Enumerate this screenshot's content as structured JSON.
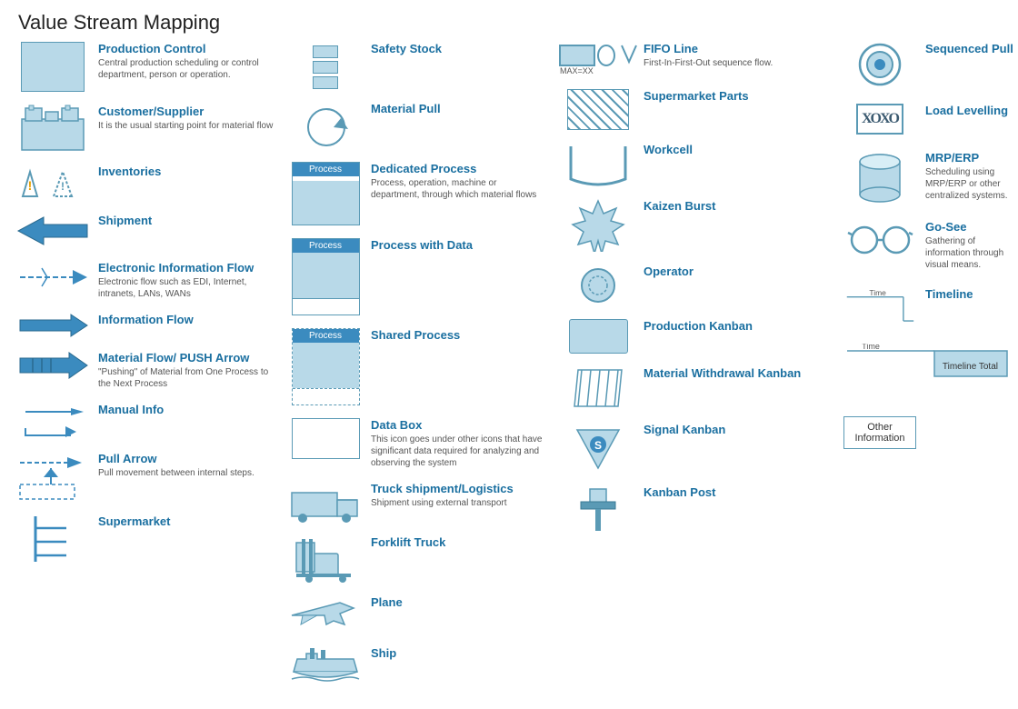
{
  "title": "Value Stream Mapping",
  "columns": [
    {
      "items": [
        {
          "name": "production-control",
          "title": "Production Control",
          "desc": "Central production scheduling or control department, person or operation.",
          "iconType": "prod-ctrl"
        },
        {
          "name": "customer-supplier",
          "title": "Customer/Supplier",
          "desc": "It is the usual starting point for material flow",
          "iconType": "factory"
        },
        {
          "name": "inventories",
          "title": "Inventories",
          "desc": "",
          "iconType": "inventories"
        },
        {
          "name": "shipment",
          "title": "Shipment",
          "desc": "",
          "iconType": "shipment"
        },
        {
          "name": "electronic-info-flow",
          "title": "Electronic Information Flow",
          "desc": "Electronic flow such as EDI, Internet, intranets, LANs, WANs",
          "iconType": "elec-info"
        },
        {
          "name": "information-flow",
          "title": "Information Flow",
          "desc": "",
          "iconType": "info-flow"
        },
        {
          "name": "material-flow-push",
          "title": "Material Flow/ PUSH Arrow",
          "desc": "\"Pushing\" of Material from One Process to the Next Process",
          "iconType": "push-arrow"
        },
        {
          "name": "manual-info",
          "title": "Manual Info",
          "desc": "",
          "iconType": "manual-info"
        },
        {
          "name": "pull-arrow",
          "title": "Pull Arrow",
          "desc": "Pull movement between internal steps.",
          "iconType": "pull-arrow"
        },
        {
          "name": "supermarket",
          "title": "Supermarket",
          "desc": "",
          "iconType": "supermarket"
        }
      ]
    },
    {
      "items": [
        {
          "name": "safety-stock",
          "title": "Safety Stock",
          "desc": "",
          "iconType": "safety-stock"
        },
        {
          "name": "material-pull",
          "title": "Material Pull",
          "desc": "",
          "iconType": "material-pull"
        },
        {
          "name": "dedicated-process",
          "title": "Dedicated Process",
          "desc": "Process, operation, machine or department, through which material flows",
          "iconType": "process-box"
        },
        {
          "name": "process-with-data",
          "title": "Process with Data",
          "desc": "",
          "iconType": "process-box2"
        },
        {
          "name": "shared-process",
          "title": "Shared Process",
          "desc": "",
          "iconType": "process-box3"
        },
        {
          "name": "data-box",
          "title": "Data Box",
          "desc": "This icon goes under other icons that have significant data required for analyzing and observing the system",
          "iconType": "data-box"
        },
        {
          "name": "truck-shipment",
          "title": "Truck shipment/Logistics",
          "desc": "Shipment using external transport",
          "iconType": "truck"
        },
        {
          "name": "forklift-truck",
          "title": "Forklift Truck",
          "desc": "",
          "iconType": "forklift"
        },
        {
          "name": "plane",
          "title": "Plane",
          "desc": "",
          "iconType": "plane"
        },
        {
          "name": "ship",
          "title": "Ship",
          "desc": "",
          "iconType": "ship"
        }
      ]
    },
    {
      "items": [
        {
          "name": "fifo-line",
          "title": "FIFO Line",
          "desc": "First-In-First-Out sequence flow.",
          "iconType": "fifo",
          "subtext": "MAX=XX"
        },
        {
          "name": "supermarket-parts",
          "title": "Supermarket Parts",
          "desc": "",
          "iconType": "supermarket-parts"
        },
        {
          "name": "workcell",
          "title": "Workcell",
          "desc": "",
          "iconType": "workcell"
        },
        {
          "name": "kaizen-burst",
          "title": "Kaizen Burst",
          "desc": "",
          "iconType": "kaizen"
        },
        {
          "name": "operator",
          "title": "Operator",
          "desc": "",
          "iconType": "operator"
        },
        {
          "name": "production-kanban",
          "title": "Production Kanban",
          "desc": "",
          "iconType": "prod-kanban"
        },
        {
          "name": "material-withdrawal-kanban",
          "title": "Material Withdrawal Kanban",
          "desc": "",
          "iconType": "mat-kanban"
        },
        {
          "name": "signal-kanban",
          "title": "Signal Kanban",
          "desc": "",
          "iconType": "signal-kanban"
        },
        {
          "name": "kanban-post",
          "title": "Kanban Post",
          "desc": "",
          "iconType": "kanban-post"
        }
      ]
    },
    {
      "items": [
        {
          "name": "sequenced-pull",
          "title": "Sequenced Pull",
          "desc": "",
          "iconType": "seq-pull"
        },
        {
          "name": "load-levelling",
          "title": "Load Levelling",
          "desc": "",
          "iconType": "xoxo"
        },
        {
          "name": "mrp-erp",
          "title": "MRP/ERP",
          "desc": "Scheduling using MRP/ERP or other centralized systems.",
          "iconType": "mrp"
        },
        {
          "name": "go-see",
          "title": "Go-See",
          "desc": "Gathering of information through visual means.",
          "iconType": "gosee"
        },
        {
          "name": "timeline",
          "title": "Timeline",
          "desc": "",
          "iconType": "timeline"
        },
        {
          "name": "timeline-total",
          "title": "Timeline Total",
          "desc": "",
          "iconType": "timeline-total"
        },
        {
          "name": "other-information",
          "title": "Other Information",
          "desc": "",
          "iconType": "other-info"
        }
      ]
    }
  ]
}
